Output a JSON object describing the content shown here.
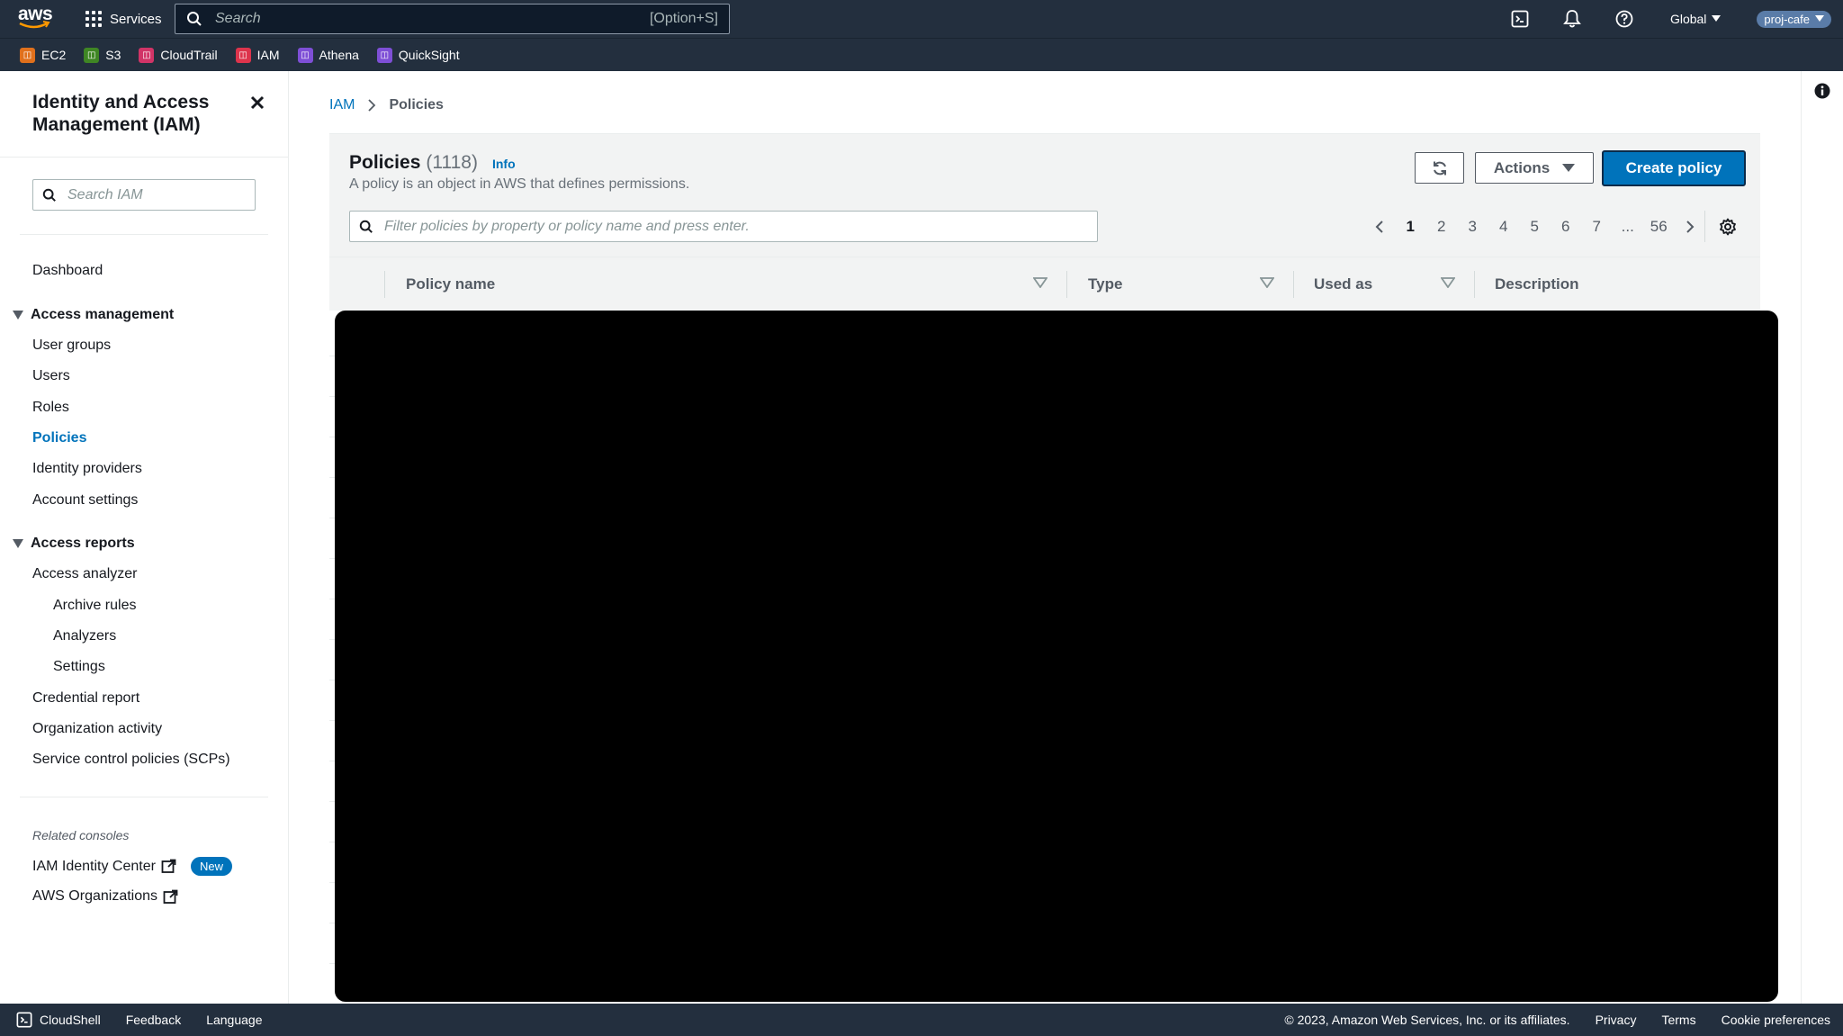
{
  "topnav": {
    "logo_text": "aws",
    "services_label": "Services",
    "search_placeholder": "Search",
    "search_shortcut": "[Option+S]",
    "region": "Global",
    "account": "proj-cafe"
  },
  "favorites": [
    {
      "label": "EC2",
      "color": "#e0701c"
    },
    {
      "label": "S3",
      "color": "#3f8624"
    },
    {
      "label": "CloudTrail",
      "color": "#d13467"
    },
    {
      "label": "IAM",
      "color": "#dd344c"
    },
    {
      "label": "Athena",
      "color": "#7e4fd6"
    },
    {
      "label": "QuickSight",
      "color": "#7e4fd6"
    }
  ],
  "sidebar": {
    "title": "Identity and Access Management (IAM)",
    "search_placeholder": "Search IAM",
    "dashboard": "Dashboard",
    "access_management": {
      "label": "Access management",
      "items": [
        "User groups",
        "Users",
        "Roles",
        "Policies",
        "Identity providers",
        "Account settings"
      ]
    },
    "access_reports": {
      "label": "Access reports",
      "analyzer": "Access analyzer",
      "analyzer_items": [
        "Archive rules",
        "Analyzers",
        "Settings"
      ],
      "items": [
        "Credential report",
        "Organization activity",
        "Service control policies (SCPs)"
      ]
    },
    "related_label": "Related consoles",
    "identity_center": "IAM Identity Center",
    "new_badge": "New",
    "organizations": "AWS Organizations"
  },
  "breadcrumb": {
    "root": "IAM",
    "current": "Policies"
  },
  "panel": {
    "title": "Policies",
    "count": "(1118)",
    "info": "Info",
    "description": "A policy is an object in AWS that defines permissions.",
    "actions_label": "Actions",
    "create_label": "Create policy",
    "filter_placeholder": "Filter policies by property or policy name and press enter.",
    "pages": [
      "1",
      "2",
      "3",
      "4",
      "5",
      "6",
      "7",
      "...",
      "56"
    ],
    "current_page": "1"
  },
  "table": {
    "columns": [
      "Policy name",
      "Type",
      "Used as",
      "Description"
    ]
  },
  "footer": {
    "cloudshell": "CloudShell",
    "feedback": "Feedback",
    "language": "Language",
    "copyright": "© 2023, Amazon Web Services, Inc. or its affiliates.",
    "privacy": "Privacy",
    "terms": "Terms",
    "cookies": "Cookie preferences"
  },
  "colors": {
    "nav_bg": "#232f3e",
    "link": "#0073bb",
    "primary_button": "#0073bb",
    "panel_bg": "#f2f3f3"
  }
}
